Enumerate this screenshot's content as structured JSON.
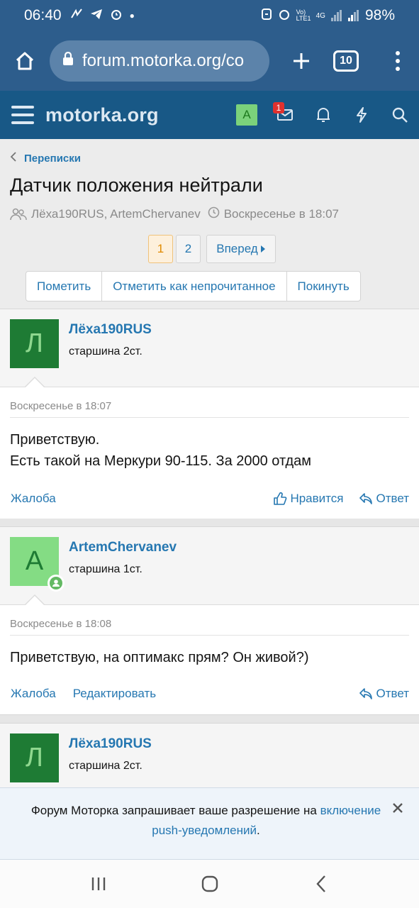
{
  "status_bar": {
    "time": "06:40",
    "battery": "98%",
    "net_label": "4G",
    "volte_label": "Vo) LTE1"
  },
  "browser": {
    "url": "forum.motorka.org/co",
    "tab_count": "10"
  },
  "header": {
    "logo": "motorka.org",
    "avatar_letter": "A",
    "inbox_badge": "1"
  },
  "breadcrumb": {
    "label": "Переписки"
  },
  "thread": {
    "title": "Датчик положения нейтрали",
    "participants": "Лёха190RUS, ArtemChervanev",
    "started": "Воскресенье в 18:07"
  },
  "pager": {
    "pages": [
      "1",
      "2"
    ],
    "next_label": "Вперед"
  },
  "actions": {
    "mark": "Пометить",
    "mark_unread": "Отметить как непрочитанное",
    "leave": "Покинуть"
  },
  "messages": [
    {
      "avatar_letter": "Л",
      "username": "Лёха190RUS",
      "user_title": "старшина 2ст.",
      "date": "Воскресенье в 18:07",
      "lines": [
        "Приветствую.",
        "Есть такой на Меркури 90-115. За 2000 отдам"
      ],
      "report": "Жалоба",
      "like": "Нравится",
      "reply": "Ответ"
    },
    {
      "avatar_letter": "A",
      "username": "ArtemChervanev",
      "user_title": "старшина 1ст.",
      "date": "Воскресенье в 18:08",
      "lines": [
        "Приветствую, на оптимакс прям? Он живой?)"
      ],
      "report": "Жалоба",
      "edit": "Редактировать",
      "reply": "Ответ"
    },
    {
      "avatar_letter": "Л",
      "username": "Лёха190RUS",
      "user_title": "старшина 2ст."
    }
  ],
  "push_notice": {
    "text": "Форум Моторка запрашивает ваше разрешение на",
    "link": "включение push-уведомлений",
    "suffix": "."
  },
  "colors": {
    "brand": "#185886",
    "link": "#2577b1",
    "chrome": "#2d5d8c"
  }
}
